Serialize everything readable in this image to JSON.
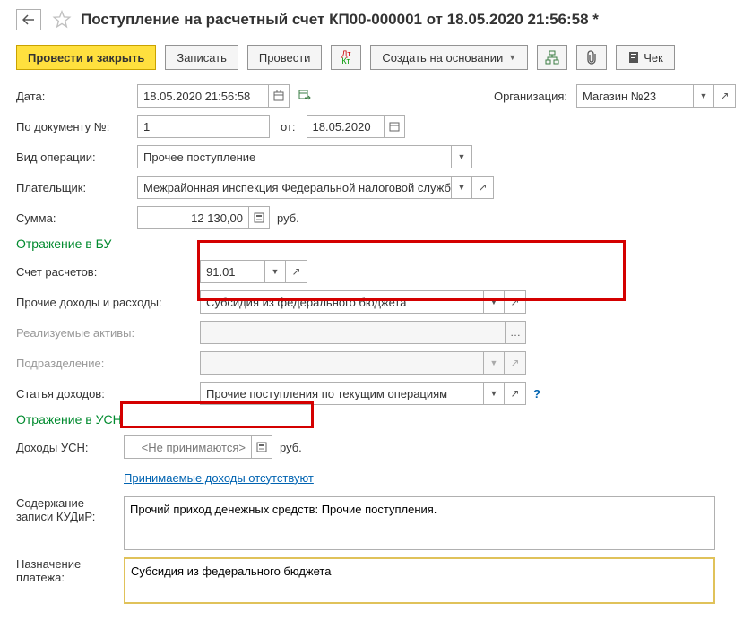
{
  "title": "Поступление на расчетный счет КП00-000001 от 18.05.2020 21:56:58 *",
  "toolbar": {
    "post_and_close": "Провести и закрыть",
    "save": "Записать",
    "post": "Провести",
    "create_based": "Создать на основании",
    "cheque": "Чек"
  },
  "header": {
    "date_label": "Дата:",
    "date_value": "18.05.2020 21:56:58",
    "org_label": "Организация:",
    "org_value": "Магазин №23",
    "doc_no_label": "По документу №:",
    "doc_no_value": "1",
    "doc_from_label": "от:",
    "doc_from_value": "18.05.2020",
    "op_type_label": "Вид операции:",
    "op_type_value": "Прочее поступление",
    "payer_label": "Плательщик:",
    "payer_value": "Межрайонная инспекция Федеральной налоговой службы",
    "amount_label": "Сумма:",
    "amount_value": "12 130,00",
    "currency": "руб."
  },
  "bu": {
    "section": "Отражение в БУ",
    "account_label": "Счет расчетов:",
    "account_value": "91.01",
    "other_label": "Прочие доходы и расходы:",
    "other_value": "Субсидия из федерального бюджета",
    "assets_label": "Реализуемые активы:",
    "assets_value": "",
    "dept_label": "Подразделение:",
    "dept_value": "",
    "income_label": "Статья доходов:",
    "income_value": "Прочие поступления по текущим операциям"
  },
  "usn": {
    "section": "Отражение в УСН",
    "income_label": "Доходы УСН:",
    "income_value": "<Не принимаются>",
    "currency": "руб.",
    "note": "Принимаемые доходы отсутствуют",
    "kudir_label1": "Содержание",
    "kudir_label2": "записи КУДиР:",
    "kudir_value": "Прочий приход денежных средств: Прочие поступления."
  },
  "purpose": {
    "label1": "Назначение",
    "label2": "платежа:",
    "value": "Субсидия из федерального бюджета"
  }
}
